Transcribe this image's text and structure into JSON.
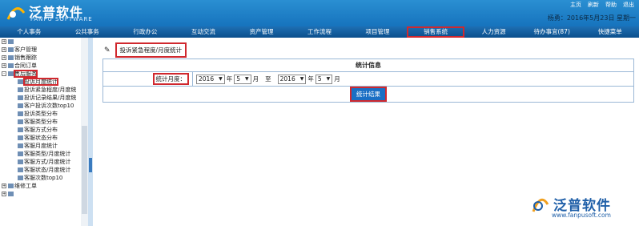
{
  "header": {
    "brand_cn": "泛普软件",
    "brand_en": "FANPU SOFTWARE",
    "top_icons": [
      "主页",
      "刷新",
      "帮助",
      "退出"
    ],
    "user_line": "杨勇：2016年5月23日 星期一"
  },
  "nav": {
    "items": [
      "个人事务",
      "公共事务",
      "行政办公",
      "互动交流",
      "资产管理",
      "工作流程",
      "项目管理",
      "销售系统",
      "人力资源",
      "待办事宜(87)",
      "快捷菜单"
    ],
    "highlighted_index": 7
  },
  "sidebar": {
    "nodes": [
      {
        "label": "",
        "level": 1
      },
      {
        "label": "客户管理",
        "level": 1
      },
      {
        "label": "销售跟踪",
        "level": 1
      },
      {
        "label": "合同订单",
        "level": 1
      },
      {
        "label": "售后服务",
        "level": 1,
        "highlighted": true
      },
      {
        "label": "投诉月度统计",
        "level": 2,
        "highlighted": true
      },
      {
        "label": "投诉紧急程度/月度统",
        "level": 2
      },
      {
        "label": "投诉记录结果/月度统",
        "level": 2
      },
      {
        "label": "客户投诉次数top10",
        "level": 2
      },
      {
        "label": "投诉类型分布",
        "level": 2
      },
      {
        "label": "客服类型分布",
        "level": 2
      },
      {
        "label": "客服方式分布",
        "level": 2
      },
      {
        "label": "客服状态分布",
        "level": 2
      },
      {
        "label": "客服月度统计",
        "level": 2
      },
      {
        "label": "客服类型/月度统计",
        "level": 2
      },
      {
        "label": "客服方式/月度统计",
        "level": 2
      },
      {
        "label": "客服状态/月度统计",
        "level": 2
      },
      {
        "label": "客服次数top10",
        "level": 2
      },
      {
        "label": "维修工单",
        "level": 1
      },
      {
        "label": "",
        "level": 1
      }
    ]
  },
  "content": {
    "breadcrumb": "投诉紧急程度/月度统计",
    "table_title": "统计信息",
    "month_label": "统计月度：",
    "from_year": "2016",
    "from_month": "5",
    "year_unit": "年",
    "month_unit": "月",
    "to_label": "至",
    "to_year": "2016",
    "to_month": "5",
    "submit_label": "统计结果"
  },
  "watermark": {
    "name": "泛普软件",
    "url": "www.fanpusoft.com"
  },
  "colors": {
    "header_blue": "#1673bd",
    "nav_blue": "#0b4f8c",
    "highlight_red": "#d0282e",
    "button_blue": "#1a6fc4"
  }
}
